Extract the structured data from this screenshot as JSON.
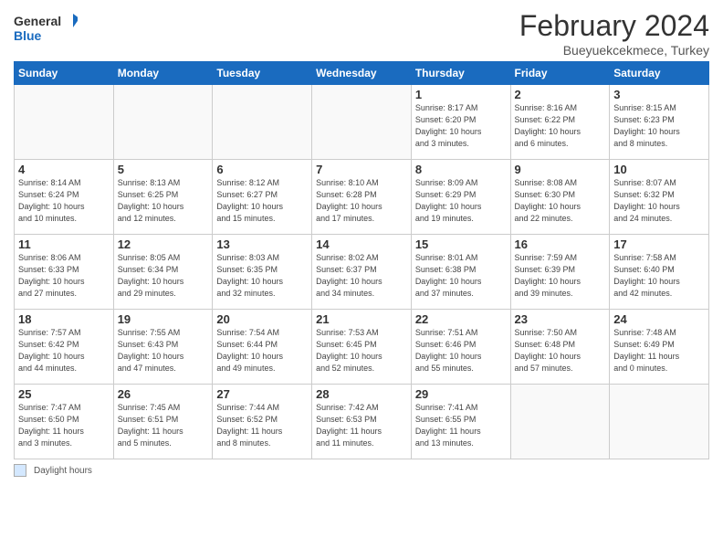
{
  "logo": {
    "line1": "General",
    "line2": "Blue"
  },
  "title": "February 2024",
  "subtitle": "Bueyuekcekmece, Turkey",
  "days_of_week": [
    "Sunday",
    "Monday",
    "Tuesday",
    "Wednesday",
    "Thursday",
    "Friday",
    "Saturday"
  ],
  "weeks": [
    [
      {
        "num": "",
        "info": ""
      },
      {
        "num": "",
        "info": ""
      },
      {
        "num": "",
        "info": ""
      },
      {
        "num": "",
        "info": ""
      },
      {
        "num": "1",
        "info": "Sunrise: 8:17 AM\nSunset: 6:20 PM\nDaylight: 10 hours\nand 3 minutes."
      },
      {
        "num": "2",
        "info": "Sunrise: 8:16 AM\nSunset: 6:22 PM\nDaylight: 10 hours\nand 6 minutes."
      },
      {
        "num": "3",
        "info": "Sunrise: 8:15 AM\nSunset: 6:23 PM\nDaylight: 10 hours\nand 8 minutes."
      }
    ],
    [
      {
        "num": "4",
        "info": "Sunrise: 8:14 AM\nSunset: 6:24 PM\nDaylight: 10 hours\nand 10 minutes."
      },
      {
        "num": "5",
        "info": "Sunrise: 8:13 AM\nSunset: 6:25 PM\nDaylight: 10 hours\nand 12 minutes."
      },
      {
        "num": "6",
        "info": "Sunrise: 8:12 AM\nSunset: 6:27 PM\nDaylight: 10 hours\nand 15 minutes."
      },
      {
        "num": "7",
        "info": "Sunrise: 8:10 AM\nSunset: 6:28 PM\nDaylight: 10 hours\nand 17 minutes."
      },
      {
        "num": "8",
        "info": "Sunrise: 8:09 AM\nSunset: 6:29 PM\nDaylight: 10 hours\nand 19 minutes."
      },
      {
        "num": "9",
        "info": "Sunrise: 8:08 AM\nSunset: 6:30 PM\nDaylight: 10 hours\nand 22 minutes."
      },
      {
        "num": "10",
        "info": "Sunrise: 8:07 AM\nSunset: 6:32 PM\nDaylight: 10 hours\nand 24 minutes."
      }
    ],
    [
      {
        "num": "11",
        "info": "Sunrise: 8:06 AM\nSunset: 6:33 PM\nDaylight: 10 hours\nand 27 minutes."
      },
      {
        "num": "12",
        "info": "Sunrise: 8:05 AM\nSunset: 6:34 PM\nDaylight: 10 hours\nand 29 minutes."
      },
      {
        "num": "13",
        "info": "Sunrise: 8:03 AM\nSunset: 6:35 PM\nDaylight: 10 hours\nand 32 minutes."
      },
      {
        "num": "14",
        "info": "Sunrise: 8:02 AM\nSunset: 6:37 PM\nDaylight: 10 hours\nand 34 minutes."
      },
      {
        "num": "15",
        "info": "Sunrise: 8:01 AM\nSunset: 6:38 PM\nDaylight: 10 hours\nand 37 minutes."
      },
      {
        "num": "16",
        "info": "Sunrise: 7:59 AM\nSunset: 6:39 PM\nDaylight: 10 hours\nand 39 minutes."
      },
      {
        "num": "17",
        "info": "Sunrise: 7:58 AM\nSunset: 6:40 PM\nDaylight: 10 hours\nand 42 minutes."
      }
    ],
    [
      {
        "num": "18",
        "info": "Sunrise: 7:57 AM\nSunset: 6:42 PM\nDaylight: 10 hours\nand 44 minutes."
      },
      {
        "num": "19",
        "info": "Sunrise: 7:55 AM\nSunset: 6:43 PM\nDaylight: 10 hours\nand 47 minutes."
      },
      {
        "num": "20",
        "info": "Sunrise: 7:54 AM\nSunset: 6:44 PM\nDaylight: 10 hours\nand 49 minutes."
      },
      {
        "num": "21",
        "info": "Sunrise: 7:53 AM\nSunset: 6:45 PM\nDaylight: 10 hours\nand 52 minutes."
      },
      {
        "num": "22",
        "info": "Sunrise: 7:51 AM\nSunset: 6:46 PM\nDaylight: 10 hours\nand 55 minutes."
      },
      {
        "num": "23",
        "info": "Sunrise: 7:50 AM\nSunset: 6:48 PM\nDaylight: 10 hours\nand 57 minutes."
      },
      {
        "num": "24",
        "info": "Sunrise: 7:48 AM\nSunset: 6:49 PM\nDaylight: 11 hours\nand 0 minutes."
      }
    ],
    [
      {
        "num": "25",
        "info": "Sunrise: 7:47 AM\nSunset: 6:50 PM\nDaylight: 11 hours\nand 3 minutes."
      },
      {
        "num": "26",
        "info": "Sunrise: 7:45 AM\nSunset: 6:51 PM\nDaylight: 11 hours\nand 5 minutes."
      },
      {
        "num": "27",
        "info": "Sunrise: 7:44 AM\nSunset: 6:52 PM\nDaylight: 11 hours\nand 8 minutes."
      },
      {
        "num": "28",
        "info": "Sunrise: 7:42 AM\nSunset: 6:53 PM\nDaylight: 11 hours\nand 11 minutes."
      },
      {
        "num": "29",
        "info": "Sunrise: 7:41 AM\nSunset: 6:55 PM\nDaylight: 11 hours\nand 13 minutes."
      },
      {
        "num": "",
        "info": ""
      },
      {
        "num": "",
        "info": ""
      }
    ]
  ],
  "legend": {
    "box_label": "Daylight hours"
  }
}
